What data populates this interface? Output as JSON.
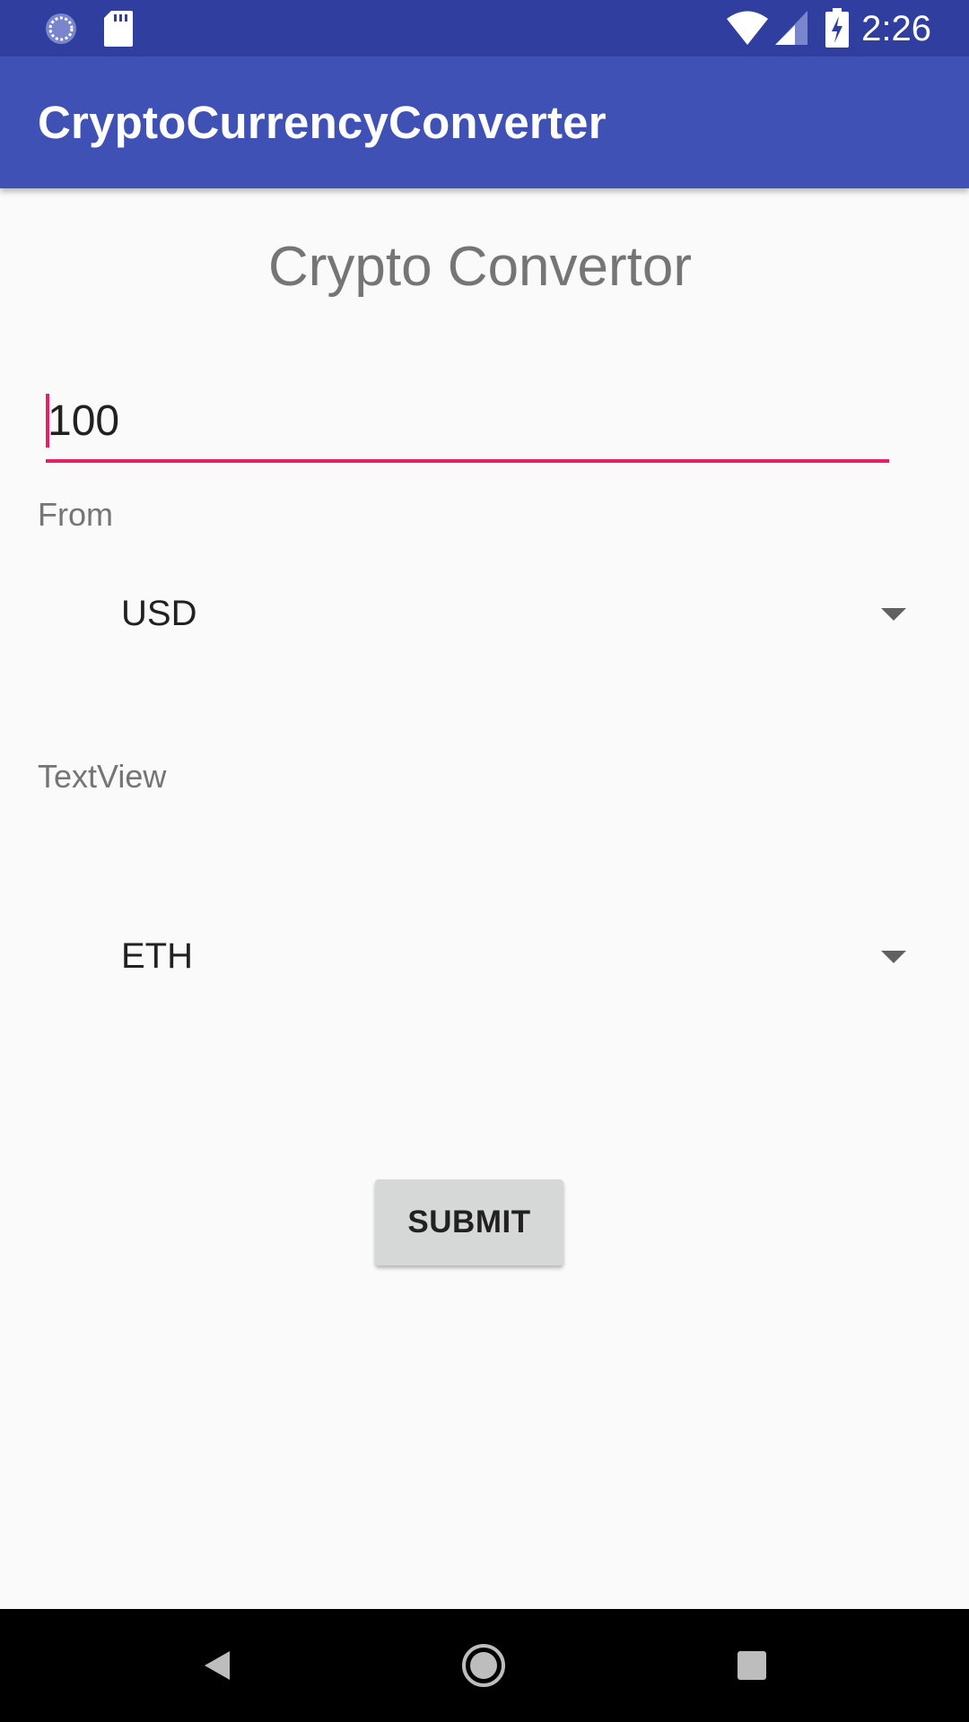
{
  "status_bar": {
    "time": "2:26",
    "left_icons": [
      "sync-icon",
      "sd-card-icon"
    ],
    "right_icons": [
      "wifi-icon",
      "cell-signal-icon",
      "battery-charging-icon"
    ],
    "background": "#303f9f"
  },
  "app_bar": {
    "title": "CryptoCurrencyConverter",
    "background": "#3f51b5"
  },
  "main": {
    "heading": "Crypto Convertor",
    "amount_input": {
      "value": "100"
    },
    "from_label": "From",
    "from_spinner": {
      "selected": "USD"
    },
    "result_label": "TextView",
    "to_spinner": {
      "selected": "ETH"
    },
    "submit_label": "SUBMIT"
  },
  "nav_bar": {
    "buttons": [
      "back-icon",
      "home-icon",
      "recents-icon"
    ]
  },
  "colors": {
    "accent": "#e91e63",
    "primary": "#3f51b5",
    "primary_dark": "#303f9f"
  }
}
